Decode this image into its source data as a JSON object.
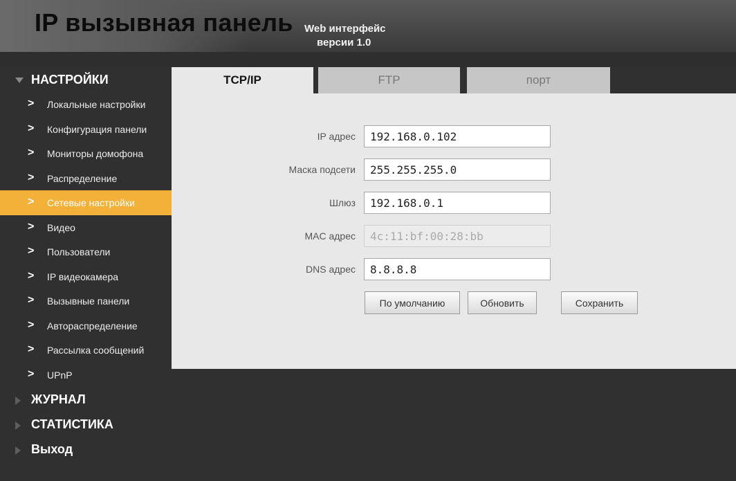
{
  "header": {
    "title": "IP вызывная панель",
    "subtitle_line1": "Web интерфейс",
    "subtitle_line2": "версии 1.0"
  },
  "sidebar": {
    "settings_label": "НАСТРОЙКИ",
    "items": [
      {
        "label": "Локальные настройки"
      },
      {
        "label": "Конфигурация панели"
      },
      {
        "label": "Мониторы домофона"
      },
      {
        "label": "Распределение"
      },
      {
        "label": "Сетевые настройки"
      },
      {
        "label": "Видео"
      },
      {
        "label": "Пользователи"
      },
      {
        "label": "IP видеокамера"
      },
      {
        "label": "Вызывные панели"
      },
      {
        "label": "Автораспределение"
      },
      {
        "label": "Рассылка сообщений"
      },
      {
        "label": "UPnP"
      }
    ],
    "active_item": "Сетевые настройки",
    "journal_label": "ЖУРНАЛ",
    "stats_label": "СТАТИСТИКА",
    "exit_label": "Выход"
  },
  "tabs": [
    {
      "label": "TCP/IP",
      "active": true
    },
    {
      "label": "FTP",
      "active": false
    },
    {
      "label": "порт",
      "active": false
    }
  ],
  "form": {
    "ip_label": "IP адрес",
    "ip_value": "192.168.0.102",
    "mask_label": "Маска подсети",
    "mask_value": "255.255.255.0",
    "gateway_label": "Шлюз",
    "gateway_value": "192.168.0.1",
    "mac_label": "MAC адрес",
    "mac_value": "4c:11:bf:00:28:bb",
    "dns_label": "DNS адрес",
    "dns_value": "8.8.8.8"
  },
  "buttons": {
    "default_label": "По умолчанию",
    "refresh_label": "Обновить",
    "save_label": "Сохранить"
  },
  "colors": {
    "active_item_bg": "#f4b13a",
    "sidebar_bg": "#303030",
    "panel_bg": "#e8e8e8"
  }
}
